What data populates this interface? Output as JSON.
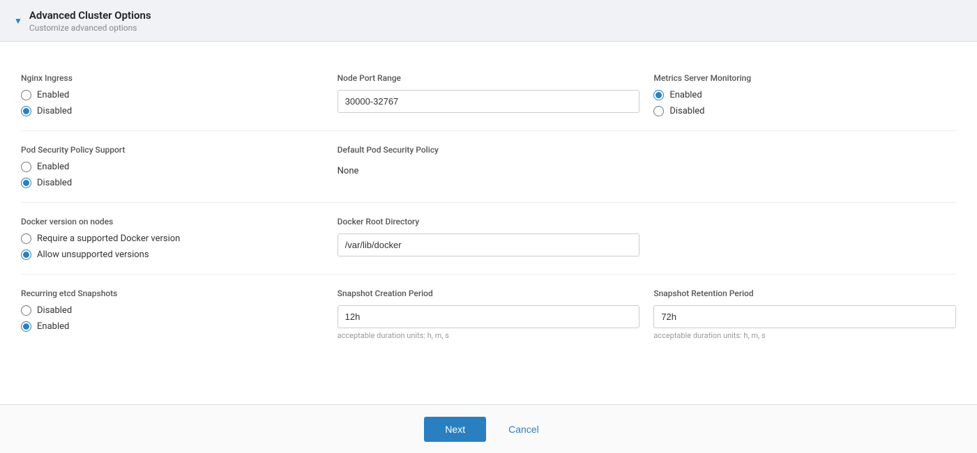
{
  "header": {
    "title": "Advanced Cluster Options",
    "subtitle": "Customize advanced options",
    "chevron": "▼"
  },
  "sections": {
    "nginx_ingress": {
      "label": "Nginx Ingress",
      "options": [
        "Enabled",
        "Disabled"
      ],
      "selected": "Disabled"
    },
    "node_port_range": {
      "label": "Node Port Range",
      "value": "30000-32767"
    },
    "metrics_server": {
      "label": "Metrics Server Monitoring",
      "options": [
        "Enabled",
        "Disabled"
      ],
      "selected": "Enabled"
    },
    "pod_security_policy": {
      "label": "Pod Security Policy Support",
      "options": [
        "Enabled",
        "Disabled"
      ],
      "selected": "Disabled"
    },
    "default_pod_security": {
      "label": "Default Pod Security Policy",
      "value": "None"
    },
    "docker_version": {
      "label": "Docker version on nodes",
      "options": [
        "Require a supported Docker version",
        "Allow unsupported versions"
      ],
      "selected": "Allow unsupported versions"
    },
    "docker_root_dir": {
      "label": "Docker Root Directory",
      "value": "/var/lib/docker"
    },
    "recurring_etcd": {
      "label": "Recurring etcd Snapshots",
      "options": [
        "Disabled",
        "Enabled"
      ],
      "selected": "Enabled"
    },
    "snapshot_creation": {
      "label": "Snapshot Creation Period",
      "value": "12h",
      "hint": "acceptable duration units: h, m, s"
    },
    "snapshot_retention": {
      "label": "Snapshot Retention Period",
      "value": "72h",
      "hint": "acceptable duration units: h, m, s"
    }
  },
  "footer": {
    "next_label": "Next",
    "cancel_label": "Cancel"
  }
}
